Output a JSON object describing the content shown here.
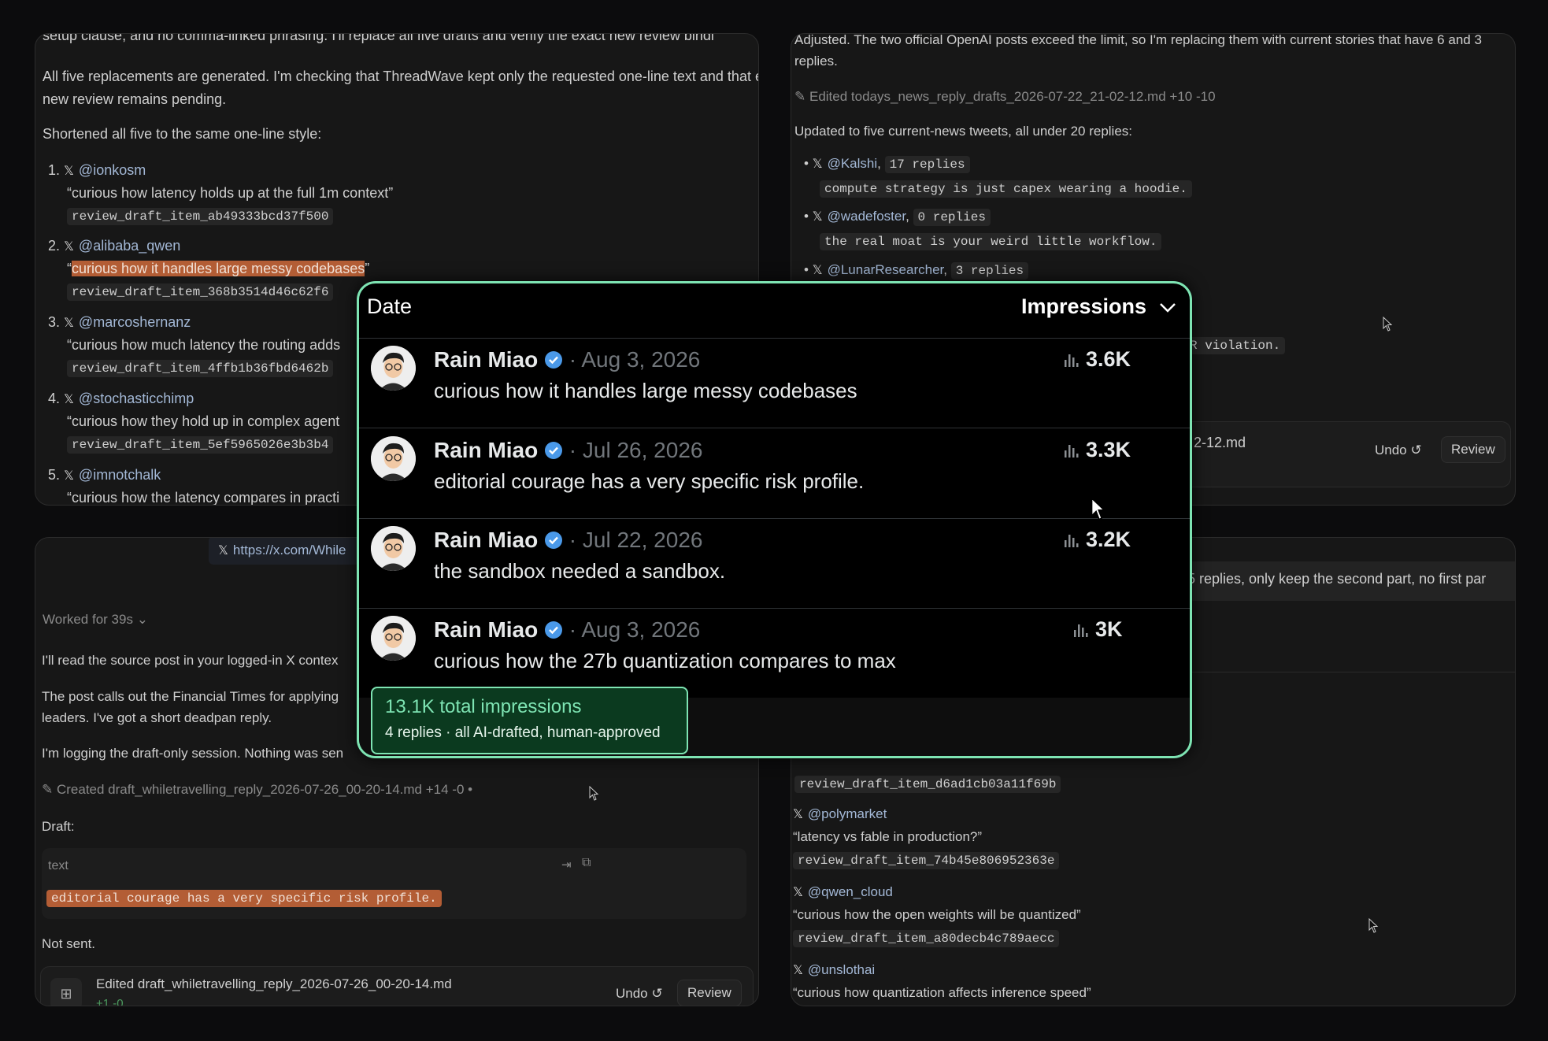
{
  "top_left": {
    "p0": "setup clause, and no comma-linked phrasing. I'll replace all five drafts and verify the exact new review bindi",
    "p1": "All five replacements are generated. I'm checking that ThreadWave kept only the requested one-line text and that every new review remains pending.",
    "p2": "Shortened all five to the same one-line style:",
    "items": [
      {
        "num": "1.",
        "handle": "@ionkosm",
        "text": "“curious how latency holds up at the full 1m context”",
        "code": "review_draft_item_ab49333bcd37f500"
      },
      {
        "num": "2.",
        "handle": "@alibaba_qwen",
        "q_open": "“",
        "text": "curious how it handles large messy codebases",
        "q_close": "”",
        "code": "review_draft_item_368b3514d46c62f6"
      },
      {
        "num": "3.",
        "handle": "@marcoshernanz",
        "text": "“curious how much latency the routing adds",
        "code": "review_draft_item_4ffb1b36fbd6462b"
      },
      {
        "num": "4.",
        "handle": "@stochasticchimp",
        "text": "“curious how they hold up in complex agent",
        "code": "review_draft_item_5ef5965026e3b3b4"
      },
      {
        "num": "5.",
        "handle": "@imnotchalk",
        "text": "“curious how the latency compares in practi"
      }
    ]
  },
  "top_right": {
    "p0": "Adjusted. The two official OpenAI posts exceed the limit, so I'm replacing them with current stories that have 6 and 3 replies.",
    "edited": "Edited todays_news_reply_drafts_2026-07-22_21-02-12.md",
    "edited_diff": "+10 -10",
    "p1": "Updated to five current-news tweets, all under 20 replies:",
    "items": [
      {
        "handle": "@Kalshi",
        "replies": "17 replies",
        "text": "compute strategy is just capex wearing a hoodie."
      },
      {
        "handle": "@wadefoster",
        "replies": "0 replies",
        "text": "the real moat is your weird little workflow."
      },
      {
        "handle": "@LunarResearcher",
        "replies": "3 replies"
      }
    ],
    "partial_code": "R violation.",
    "file_partial": "2-12.md",
    "undo": "Undo",
    "review": "Review"
  },
  "bottom_left": {
    "url": "https://x.com/While",
    "worked": "Worked for 39s",
    "p1": "I'll read the source post in your logged-in X contex",
    "p2a": "The post calls out the Financial Times for applying",
    "p2b": "leaders. I've got a short deadpan reply.",
    "p3": "I'm logging the draft-only session. Nothing was sen",
    "created": "Created draft_whiletravelling_reply_2026-07-26_00-20-14.md",
    "created_diff": "+14 -0",
    "draft_label": "Draft:",
    "text_label": "text",
    "draft_text": "editorial courage has a very specific risk profile.",
    "not_sent": "Not sent.",
    "edited_file": "Edited draft_whiletravelling_reply_2026-07-26_00-20-14.md",
    "edited_diff": "+1 -0",
    "undo": "Undo",
    "review": "Review"
  },
  "bottom_right": {
    "prompt": "5 replies, only keep the second part, no first par",
    "items": [
      {
        "code": "review_draft_item_d6ad1cb03a11f69b"
      },
      {
        "handle": "@polymarket",
        "text": "“latency vs fable in production?”",
        "code": "review_draft_item_74b45e806952363e"
      },
      {
        "handle": "@qwen_cloud",
        "text": "“curious how the open weights will be quantized”",
        "code": "review_draft_item_a80decb4c789aecc"
      },
      {
        "handle": "@unslothai",
        "text": "“curious how quantization affects inference speed”"
      }
    ]
  },
  "popup": {
    "date_header": "Date",
    "sort_label": "Impressions",
    "rows": [
      {
        "name": "Rain Miao",
        "date": "· Aug 3, 2026",
        "text": "curious how it handles large messy codebases",
        "views": "3.6K"
      },
      {
        "name": "Rain Miao",
        "date": "· Jul 26, 2026",
        "text": "editorial courage has a very specific risk profile.",
        "views": "3.3K"
      },
      {
        "name": "Rain Miao",
        "date": "· Jul 22, 2026",
        "text": "the sandbox needed a sandbox.",
        "views": "3.2K"
      },
      {
        "name": "Rain Miao",
        "date": "· Aug 3, 2026",
        "text": "curious how the 27b quantization compares to max",
        "views": "3K"
      }
    ],
    "total": "13.1K total impressions",
    "sub": "4 replies · all AI-drafted, human-approved"
  },
  "colors": {
    "accent": "#7ee4b3",
    "verified": "#4a99e9",
    "highlight": "#b35d35"
  }
}
